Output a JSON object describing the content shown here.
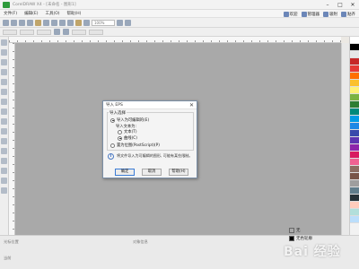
{
  "window": {
    "title": "CorelDRAW X4 - [未命名 - 图形1]",
    "controls": [
      "–",
      "□",
      "✕"
    ]
  },
  "menu": {
    "items": [
      "文件(F)",
      "编辑(E)",
      "工具(O)",
      "帮助(H)"
    ],
    "right_buttons": [
      "欢迎",
      "管理器",
      "吸附",
      "贴齐"
    ]
  },
  "toolbar": {
    "zoom": "100%"
  },
  "dialog": {
    "title": "导入 EPS",
    "close": "✕",
    "group_label": "导入选择",
    "option1": "导入为可编辑的(E)",
    "sub_label": "导入文本为:",
    "sub1": "文本(T)",
    "sub2": "曲线(C)",
    "option2": "置为位图(PostScript)(P)",
    "info": "将文件导入为可编辑的图形, 可能有某些限制。",
    "ok": "确定",
    "cancel": "取消",
    "help": "帮助(H)"
  },
  "status": {
    "left_top": "光标位置",
    "left_bottom": "当前",
    "middle": "对象信息",
    "fill_label": "无",
    "outline_label": "无色轮廓"
  },
  "palette": [
    "#ffffff",
    "#000000",
    "#e6e6e6",
    "#c62828",
    "#e53935",
    "#ff6f00",
    "#fbc02d",
    "#fff176",
    "#7cb342",
    "#2e7d32",
    "#00897b",
    "#039be5",
    "#1e88e5",
    "#3949ab",
    "#5e35b1",
    "#8e24aa",
    "#d81b60",
    "#f06292",
    "#8d6e63",
    "#795548",
    "#9e9e9e",
    "#607d8b",
    "#263238",
    "#ffccbc",
    "#b2dfdb",
    "#bbdefb"
  ],
  "watermark": "Bai 经验"
}
